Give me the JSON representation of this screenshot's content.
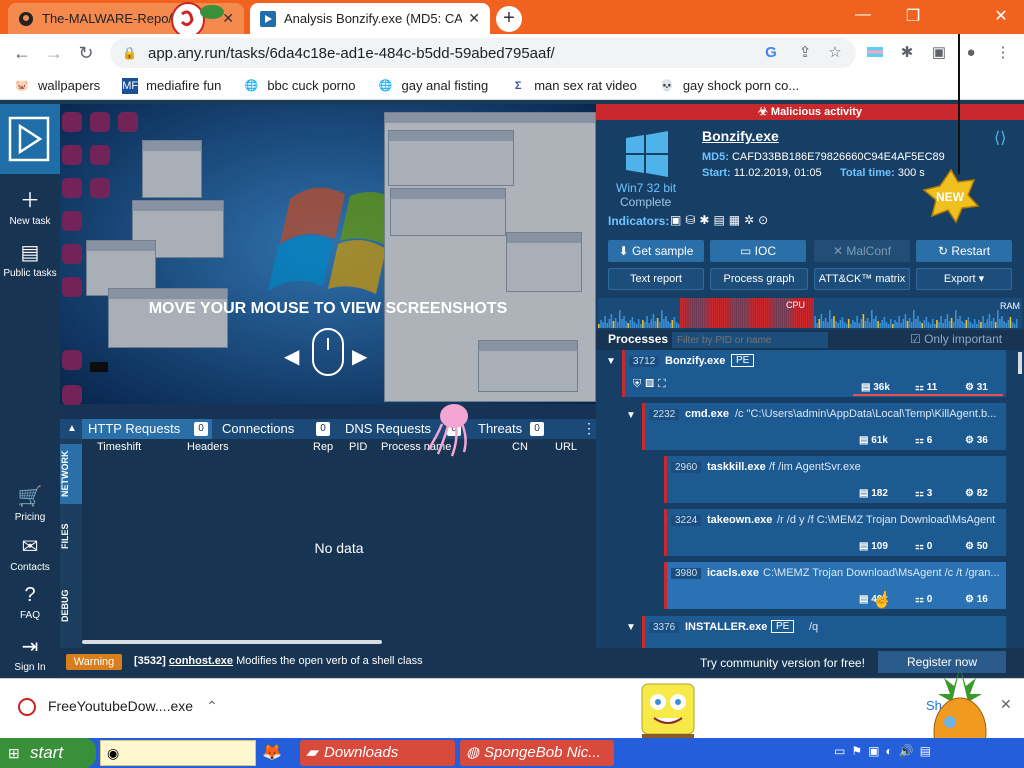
{
  "browser": {
    "tabs": [
      {
        "title": "The-MALWARE-Repo/",
        "active": false
      },
      {
        "title": "Analysis Bonzify.exe (MD5: CA",
        "active": true
      }
    ],
    "url": "app.any.run/tasks/6da4c18e-ad1e-484c-b5dd-59abed795aaf/",
    "bookmarks": [
      "wallpapers",
      "mediafire fun",
      "bbc cuck porno",
      "gay anal fisting",
      "man sex rat video",
      "gay shock porn co..."
    ]
  },
  "leftnav": {
    "items": [
      {
        "label": "New task",
        "icon": "plus-icon"
      },
      {
        "label": "Public tasks",
        "icon": "document-icon"
      },
      {
        "label": "Pricing",
        "icon": "cart-icon"
      },
      {
        "label": "Contacts",
        "icon": "mail-icon"
      },
      {
        "label": "FAQ",
        "icon": "question-icon"
      },
      {
        "label": "Sign In",
        "icon": "signin-icon"
      }
    ]
  },
  "vm": {
    "overlay_text": "MOVE YOUR MOUSE TO VIEW SCREENSHOTS"
  },
  "network": {
    "tabs": [
      {
        "label": "HTTP Requests",
        "count": "0"
      },
      {
        "label": "Connections",
        "count": "0"
      },
      {
        "label": "DNS Requests",
        "count": "0"
      },
      {
        "label": "Threats",
        "count": "0"
      }
    ],
    "columns": [
      "Timeshift",
      "Headers",
      "Rep",
      "PID",
      "Process name",
      "CN",
      "URL"
    ],
    "side_tabs": [
      "NETWORK",
      "FILES",
      "DEBUG"
    ],
    "empty": "No data"
  },
  "task": {
    "banner": "Malicious activity",
    "os": "Win7 32 bit",
    "status": "Complete",
    "filename": "Bonzify.exe",
    "md5_label": "MD5:",
    "md5": "CAFD33BB186E79826660C94E4AF5EC89",
    "start_label": "Start:",
    "start": "11.02.2019, 01:05",
    "total_label": "Total time:",
    "total": "300 s",
    "indicators_label": "Indicators:",
    "buttons": [
      "Get sample",
      "IOC",
      "MalConf",
      "Restart"
    ],
    "buttons2": [
      "Text report",
      "Process graph",
      "ATT&CK™ matrix",
      "Export"
    ],
    "cpu_label": "CPU",
    "ram_label": "RAM",
    "processes_label": "Processes",
    "filter_placeholder": "Filter by PID or name",
    "only_important": "Only important"
  },
  "processes": [
    {
      "pid": "3712",
      "name": "Bonzify.exe",
      "tag": "PE",
      "cmd": "",
      "s1": "36k",
      "s2": "11",
      "s3": "31"
    },
    {
      "pid": "2232",
      "name": "cmd.exe",
      "tag": "",
      "cmd": "/c \"C:\\Users\\admin\\AppData\\Local\\Temp\\KillAgent.b...",
      "s1": "61k",
      "s2": "6",
      "s3": "36"
    },
    {
      "pid": "2960",
      "name": "taskkill.exe",
      "tag": "",
      "cmd": "/f /im AgentSvr.exe",
      "s1": "182",
      "s2": "3",
      "s3": "82"
    },
    {
      "pid": "3224",
      "name": "takeown.exe",
      "tag": "",
      "cmd": "/r /d y /f C:\\MEMZ Trojan Download\\MsAgent",
      "s1": "109",
      "s2": "0",
      "s3": "50"
    },
    {
      "pid": "3980",
      "name": "icacls.exe",
      "tag": "",
      "cmd": "C:\\MEMZ Trojan Download\\MsAgent /c /t /gran...",
      "s1": "40k",
      "s2": "0",
      "s3": "16"
    },
    {
      "pid": "3376",
      "name": "INSTALLER.exe",
      "tag": "PE",
      "cmd": "/q",
      "s1": "",
      "s2": "",
      "s3": ""
    }
  ],
  "status": {
    "warning": "Warning",
    "pid": "[3532]",
    "proc": "conhost.exe",
    "msg": "Modifies the open verb of a shell class",
    "community": "Try community version for free!",
    "register": "Register now"
  },
  "downloads": {
    "file": "FreeYoutubeDow....exe",
    "show_all": "Sh"
  },
  "taskbar": {
    "start": "start",
    "items": [
      "Downloads",
      "SpongeBob Nic..."
    ]
  }
}
